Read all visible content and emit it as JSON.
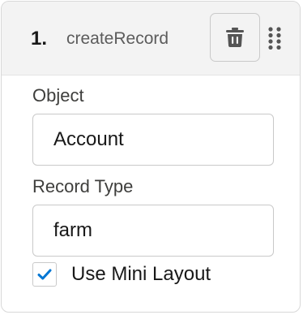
{
  "step": {
    "number": "1.",
    "name": "createRecord"
  },
  "icons": {
    "delete": "trash-icon",
    "drag": "drag-handle-icon",
    "checkmark": "checkmark-icon"
  },
  "fields": {
    "object": {
      "label": "Object",
      "value": "Account"
    },
    "record_type": {
      "label": "Record Type",
      "value": "farm"
    }
  },
  "options": {
    "use_mini_layout": {
      "label": "Use Mini Layout",
      "checked": true
    }
  },
  "colors": {
    "header_bg": "#f3f3f3",
    "border": "#c9c9c9",
    "check": "#0176d3"
  }
}
